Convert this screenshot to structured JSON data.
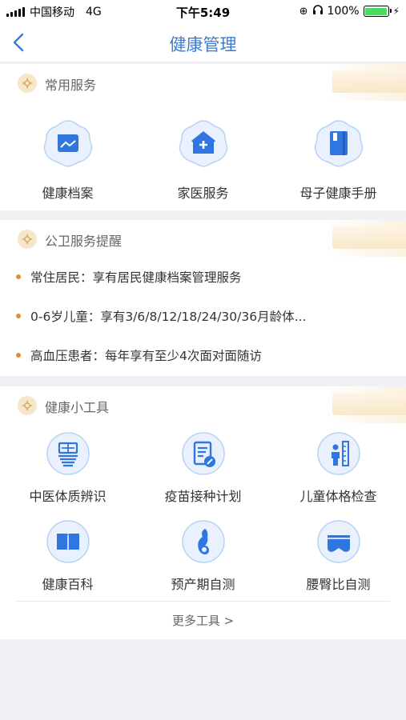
{
  "status": {
    "carrier": "中国移动",
    "network": "4G",
    "time": "下午5:49",
    "battery": "100%",
    "battery_level": 1.0
  },
  "nav": {
    "title": "健康管理"
  },
  "common_services": {
    "title": "常用服务",
    "items": [
      {
        "label": "健康档案",
        "icon": "folder-icon"
      },
      {
        "label": "家医服务",
        "icon": "home-plus-icon"
      },
      {
        "label": "母子健康手册",
        "icon": "handbook-icon"
      }
    ]
  },
  "reminders": {
    "title": "公卫服务提醒",
    "items": [
      {
        "text": "常住居民：享有居民健康档案管理服务"
      },
      {
        "text": "0-6岁儿童：享有3/6/8/12/18/24/30/36月龄体..."
      },
      {
        "text": "高血压患者：每年享有至少4次面对面随访"
      }
    ]
  },
  "tools": {
    "title": "健康小工具",
    "items": [
      {
        "label": "中医体质辨识",
        "icon": "medicine-char-icon"
      },
      {
        "label": "疫苗接种计划",
        "icon": "vaccine-plan-icon"
      },
      {
        "label": "儿童体格检查",
        "icon": "child-height-icon"
      },
      {
        "label": "健康百科",
        "icon": "book-icon"
      },
      {
        "label": "预产期自测",
        "icon": "pregnancy-icon"
      },
      {
        "label": "腰臀比自测",
        "icon": "waist-hip-icon"
      }
    ],
    "more": "更多工具 >"
  },
  "colors": {
    "accent": "#3a7bd5",
    "icon_blue": "#2f76e0",
    "dot_orange": "#e8893a"
  }
}
